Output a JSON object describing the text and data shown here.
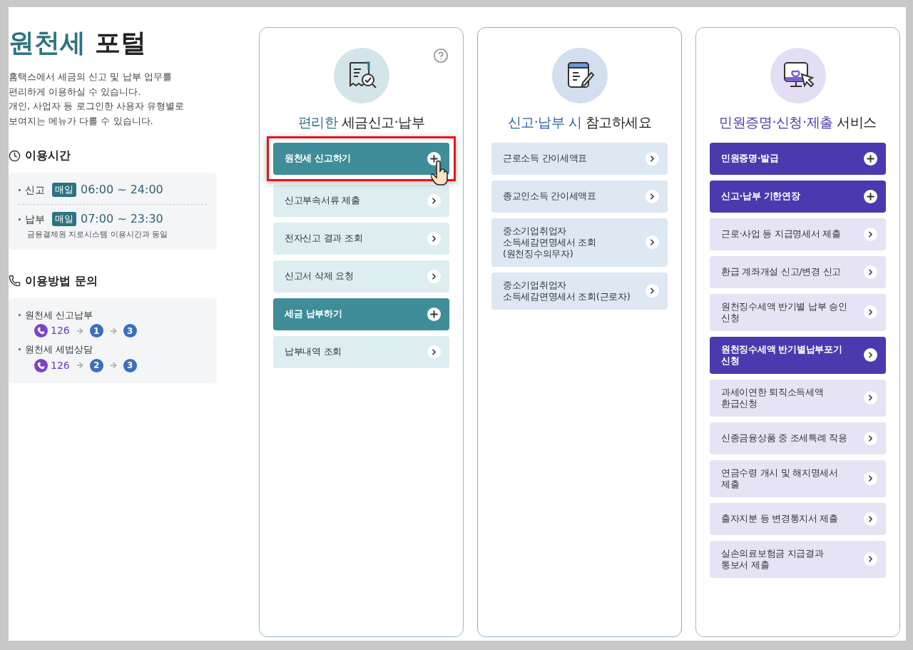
{
  "portal": {
    "title_accent": "원천세",
    "title_rest": "포털",
    "description": "홈택스에서 세금의 신고 및 납부 업무를\n편리하게 이용하실 수 있습니다.\n개인, 사업자 등 로그인한 사용자 유형별로\n보여지는 메뉴가 다를 수 있습니다."
  },
  "hours": {
    "title": "이용시간",
    "rows": [
      {
        "label": "신고",
        "badge": "매일",
        "time": "06:00 ~ 24:00"
      },
      {
        "label": "납부",
        "badge": "매일",
        "time": "07:00 ~ 23:30",
        "note": "금융결제원 지로시스템 이용시간과 동일"
      }
    ]
  },
  "inquiry": {
    "title": "이용방법 문의",
    "rows": [
      {
        "label": "원천세 신고납부",
        "phone": "126",
        "steps": [
          "1",
          "3"
        ]
      },
      {
        "label": "원천세 세법상담",
        "phone": "126",
        "steps": [
          "2",
          "3"
        ]
      }
    ]
  },
  "cards": [
    {
      "kind": "filing",
      "help": true,
      "title_accent": "편리한",
      "title_rest": "세금신고·납부",
      "items": [
        {
          "label": "원천세 신고하기",
          "kind": "primary",
          "expandable": true,
          "highlighted": true
        },
        {
          "label": "신고부속서류 제출",
          "kind": "normal",
          "expandable": false,
          "highlighted": false
        },
        {
          "label": "전자신고 결과 조회",
          "kind": "normal",
          "expandable": false,
          "highlighted": false
        },
        {
          "label": "신고서 삭제 요청",
          "kind": "normal",
          "expandable": false,
          "highlighted": false
        },
        {
          "label": "세금 납부하기",
          "kind": "primary",
          "expandable": true,
          "highlighted": false
        },
        {
          "label": "납부내역 조회",
          "kind": "normal",
          "expandable": false,
          "highlighted": false
        }
      ]
    },
    {
      "kind": "reference",
      "help": false,
      "title_accent": "신고·납부 시",
      "title_rest": "참고하세요",
      "items": [
        {
          "label": "근로소득 간이세액표",
          "kind": "normal",
          "expandable": false,
          "highlighted": false
        },
        {
          "label": "종교인소득 간이세액표",
          "kind": "normal",
          "expandable": false,
          "highlighted": false
        },
        {
          "label": "중소기업취업자\n소득세감면명세서 조회\n(원천징수의무자)",
          "kind": "normal",
          "expandable": false,
          "highlighted": false
        },
        {
          "label": "중소기업취업자\n소득세감면명세서 조회(근로자)",
          "kind": "normal",
          "expandable": false,
          "highlighted": false
        }
      ]
    },
    {
      "kind": "service",
      "help": false,
      "title_accent": "민원증명·신청·제출",
      "title_rest": "서비스",
      "items": [
        {
          "label": "민원증명·발급",
          "kind": "primary",
          "expandable": true,
          "highlighted": false
        },
        {
          "label": "신고·납부 기한연장",
          "kind": "primary",
          "expandable": true,
          "highlighted": false
        },
        {
          "label": "근로·사업 등 지급명세서 제출",
          "kind": "normal",
          "expandable": false,
          "highlighted": false
        },
        {
          "label": "환급 계좌개설 신고/변경 신고",
          "kind": "normal",
          "expandable": false,
          "highlighted": false
        },
        {
          "label": "원천징수세액 반기별 납부 승인\n신청",
          "kind": "normal",
          "expandable": false,
          "highlighted": false
        },
        {
          "label": "원천징수세액 반기별납부포기\n신청",
          "kind": "primary",
          "expandable": false,
          "highlighted": false
        },
        {
          "label": "과세이연한 퇴직소득세액\n환급신청",
          "kind": "normal",
          "expandable": false,
          "highlighted": false
        },
        {
          "label": "신종금융상품 중 조세특례 작용",
          "kind": "normal",
          "expandable": false,
          "highlighted": false
        },
        {
          "label": "연금수령 개시 및 해지명세서\n제출",
          "kind": "normal",
          "expandable": false,
          "highlighted": false
        },
        {
          "label": "출자지분 등 변경통지서 제출",
          "kind": "normal",
          "expandable": false,
          "highlighted": false
        },
        {
          "label": "실손의료보험금 지급결과\n통보서 제출",
          "kind": "normal",
          "expandable": false,
          "highlighted": false
        }
      ]
    }
  ]
}
